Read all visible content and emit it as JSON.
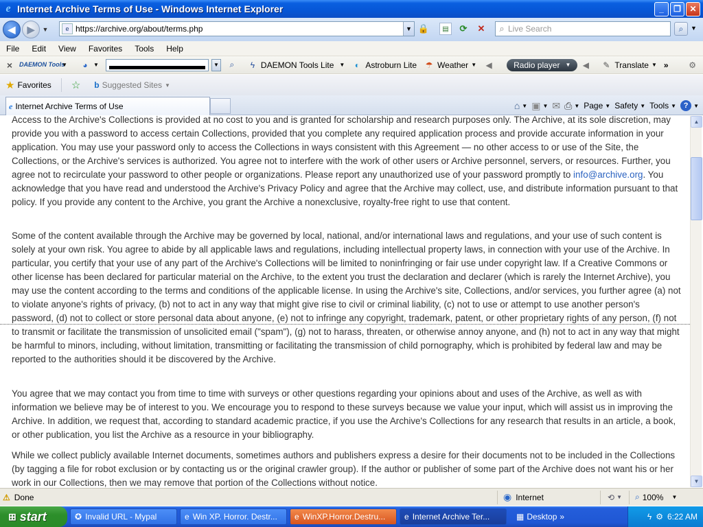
{
  "window": {
    "title": "Internet Archive Terms of Use - Windows Internet Explorer",
    "controls": {
      "minimize": "_",
      "maximize": "❐",
      "close": "✕"
    }
  },
  "address_bar": {
    "url": "https://archive.org/about/terms.php",
    "search_placeholder": "Live Search"
  },
  "menu": [
    "File",
    "Edit",
    "View",
    "Favorites",
    "Tools",
    "Help"
  ],
  "toolbar": {
    "daemon_logo": "DAEMON Tools",
    "items": [
      "DAEMON Tools Lite",
      "Astroburn Lite",
      "Weather",
      "Radio player",
      "Translate"
    ]
  },
  "favorites_bar": {
    "favorites_label": "Favorites",
    "suggested_sites": "Suggested Sites"
  },
  "tab": {
    "title": "Internet Archive Terms of Use"
  },
  "command_bar": {
    "page": "Page",
    "safety": "Safety",
    "tools": "Tools"
  },
  "content": {
    "p1_before": "Access to the Archive's Collections is provided at no cost to you and is granted for scholarship and research purposes only. The Archive, at its sole discretion, may provide you with a password to access certain Collections, provided that you complete any required application process and provide accurate information in your application. You may use your password only to access the Collections in ways consistent with this Agreement — no other access to or use of the Site, the Collections, or the Archive's services is authorized. You agree not to interfere with the work of other users or Archive personnel, servers, or resources. Further, you agree not to recirculate your password to other people or organizations. Please report any unauthorized use of your password promptly to ",
    "p1_link": "info@archive.org",
    "p1_after": ". You acknowledge that you have read and understood the Archive's Privacy Policy and agree that the Archive may collect, use, and distribute information pursuant to that policy. If you provide any content to the Archive, you grant the Archive a nonexclusive, royalty-free right to use that content.",
    "p2": "Some of the content available through the Archive may be governed by local, national, and/or international laws and regulations, and your use of such content is solely at your own risk. You agree to abide by all applicable laws and regulations, including intellectual property laws, in connection with your use of the Archive. In particular, you certify that your use of any part of the Archive's Collections will be limited to noninfringing or fair use under copyright law. If a Creative Commons or other license has been declared for particular material on the Archive, to the extent you trust the declaration and declarer (which is rarely the Internet Archive), you may use the content according to the terms and conditions of the applicable license. In using the Archive's site, Collections, and/or services, you further agree (a) not to violate anyone's rights of privacy, (b) not to act in any way that might give rise to civil or criminal liability, (c) not to use or attempt to use another person's password, (d) not to collect or store personal data about anyone, (e) not to infringe any copyright, trademark, patent, or other proprietary rights of any person, (f) not to transmit or facilitate the transmission of unsolicited email (\"spam\"), (g) not to harass, threaten, or otherwise annoy anyone, and (h) not to act in any way that might be harmful to minors, including, without limitation, transmitting or facilitating the transmission of child pornography, which is prohibited by federal law and may be reported to the authorities should it be discovered by the Archive.",
    "p3": "You agree that we may contact you from time to time with surveys or other questions regarding your opinions about and uses of the Archive, as well as with information we believe may be of interest to you. We encourage you to respond to these surveys because we value your input, which will assist us in improving the Archive. In addition, we request that, according to standard academic practice, if you use the Archive's Collections for any research that results in an article, a book, or other publication, you list the Archive as a resource in your bibliography.",
    "p4": "While we collect publicly available Internet documents, sometimes authors and publishers express a desire for their documents not to be included in the Collections (by tagging a file for robot exclusion or by contacting us or the original crawler group). If the author or publisher of some part of the Archive does not want his or her work in our Collections, then we may remove that portion of the Collections without notice."
  },
  "status_bar": {
    "status": "Done",
    "zone": "Internet",
    "zoom": "100%"
  },
  "taskbar": {
    "start": "start",
    "tasks": [
      "Invalid URL - Mypal",
      "Win XP. Horror. Destr...",
      "WinXP.Horror.Destru...",
      "Internet Archive Ter..."
    ],
    "desktop": "Desktop",
    "clock": "6:22 AM"
  }
}
